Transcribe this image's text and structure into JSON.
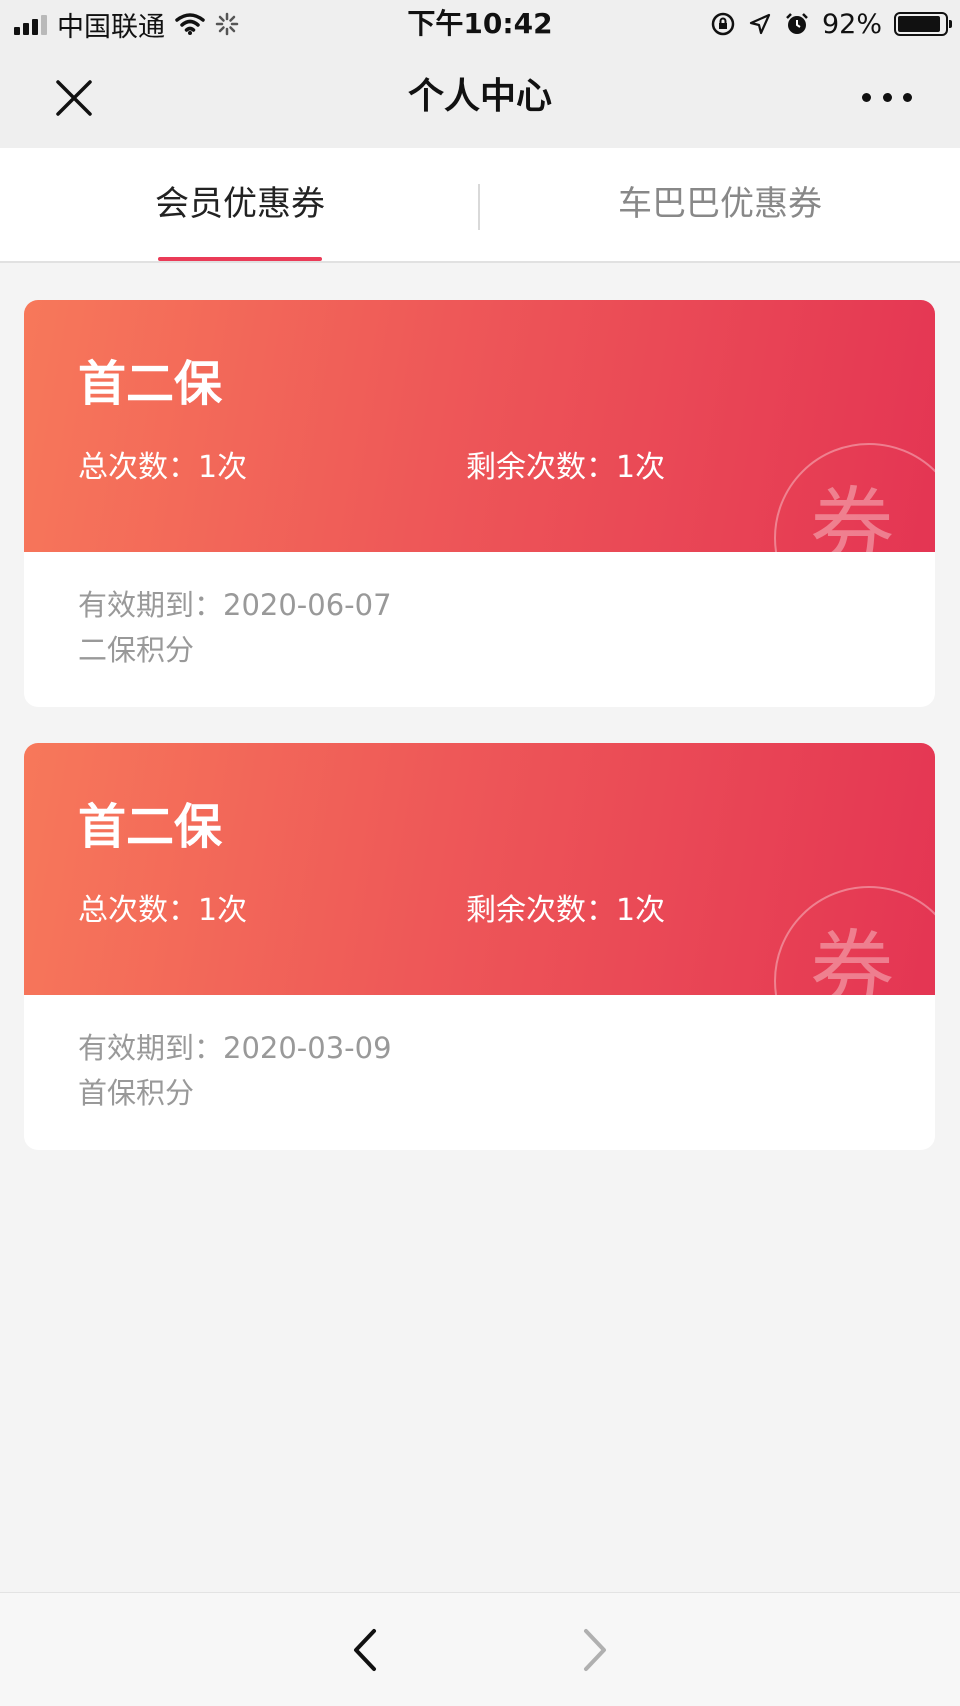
{
  "status_bar": {
    "carrier": "中国联通",
    "time": "下午10:42",
    "battery": "92%",
    "battery_level": 0.92
  },
  "nav": {
    "title": "个人中心"
  },
  "tabs": [
    {
      "label": "会员优惠券",
      "active": true
    },
    {
      "label": "车巴巴优惠券",
      "active": false
    }
  ],
  "coupons": [
    {
      "title": "首二保",
      "total": "总次数：1次",
      "remaining": "剩余次数：1次",
      "stamp": "券",
      "expiry": "有效期到：2020-06-07",
      "description": "二保积分"
    },
    {
      "title": "首二保",
      "total": "总次数：1次",
      "remaining": "剩余次数：1次",
      "stamp": "券",
      "expiry": "有效期到：2020-03-09",
      "description": "首保积分"
    }
  ],
  "colors": {
    "accent": "#ea3b57",
    "coupon_gradient_start": "#f7785a",
    "coupon_gradient_end": "#e43553"
  }
}
